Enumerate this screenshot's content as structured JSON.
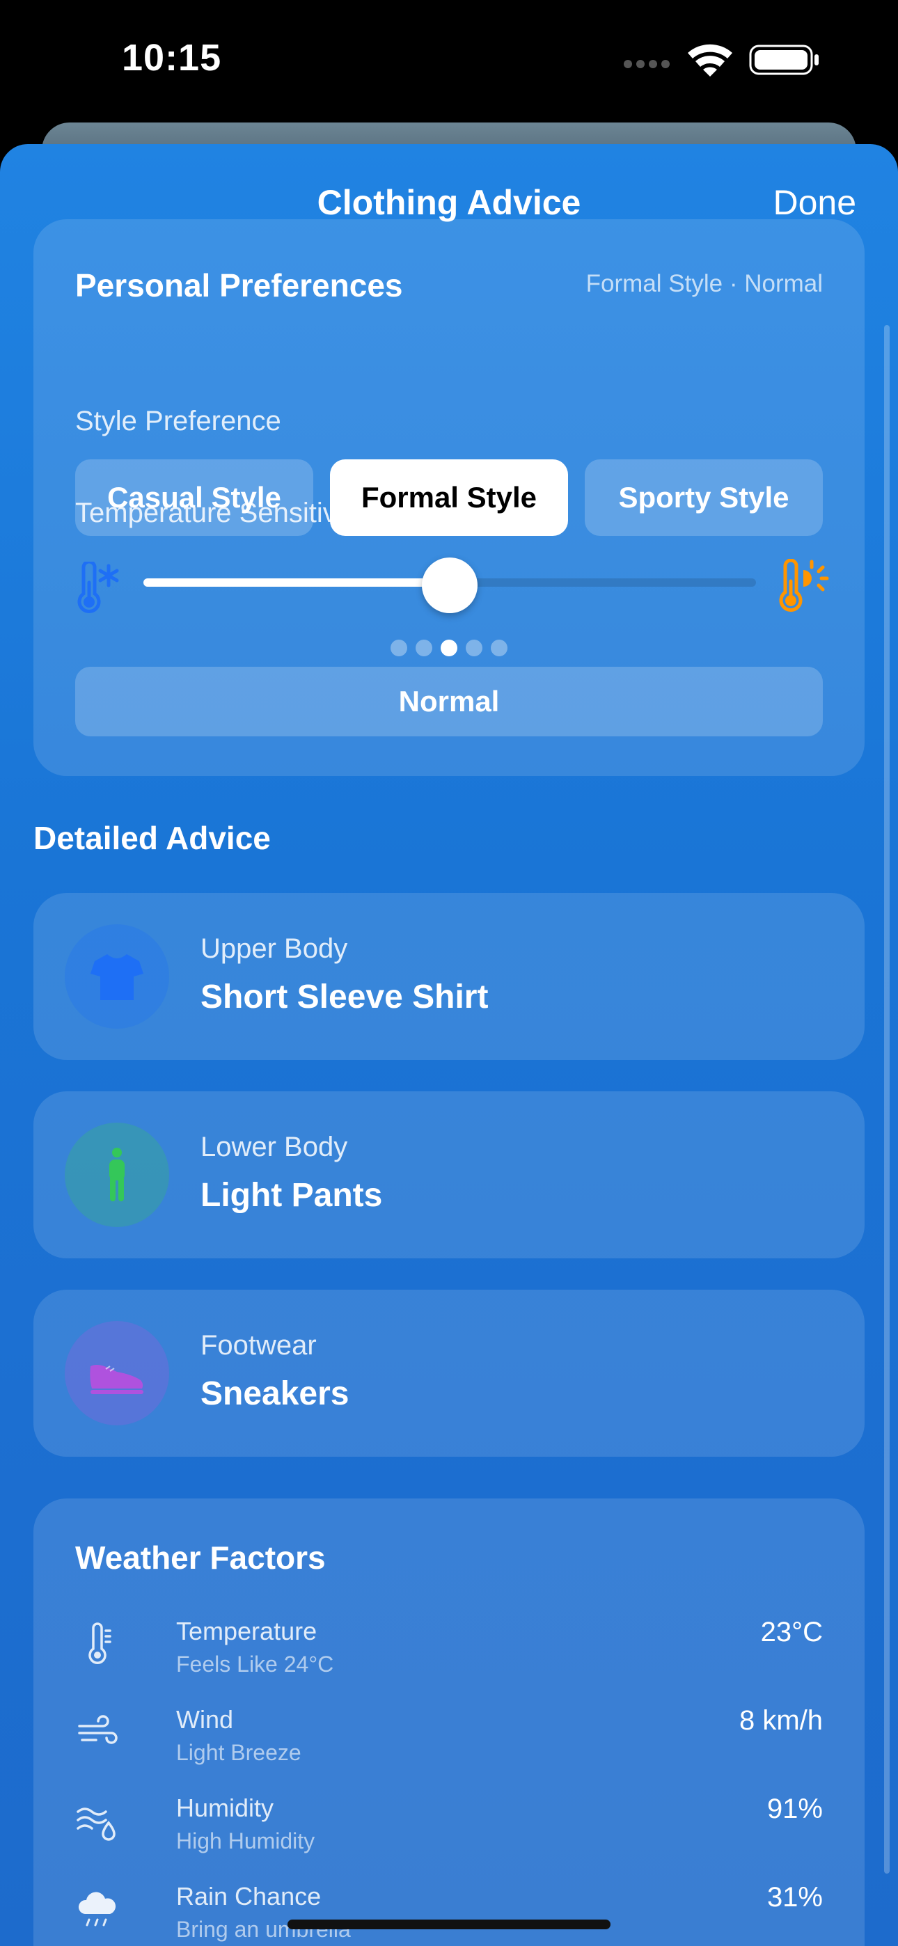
{
  "status": {
    "time": "10:15"
  },
  "sheet": {
    "title": "Clothing Advice",
    "done_label": "Done"
  },
  "preferences": {
    "title": "Personal Preferences",
    "summary": "Formal Style · Normal",
    "style_label": "Style Preference",
    "styles": [
      "Casual Style",
      "Formal Style",
      "Sporty Style"
    ],
    "selected_style": "Formal Style",
    "sensitivity_label": "Temperature Sensitivity",
    "sensitivity_level_index": 3,
    "sensitivity_levels_count": 5,
    "sensitivity_fraction": 0.5,
    "sensitivity_value": "Normal",
    "cold_icon": "thermometer-snowflake-icon",
    "hot_icon": "thermometer-sun-icon"
  },
  "detailed": {
    "heading": "Detailed Advice",
    "items": [
      {
        "category": "Upper Body",
        "value": "Short Sleeve Shirt",
        "icon": "tshirt-icon",
        "color": "#1e6ff5"
      },
      {
        "category": "Lower Body",
        "value": "Light Pants",
        "icon": "person-icon",
        "color": "#34c759"
      },
      {
        "category": "Footwear",
        "value": "Sneakers",
        "icon": "sneaker-icon",
        "color": "#af52de"
      }
    ]
  },
  "weather": {
    "title": "Weather Factors",
    "rows": [
      {
        "name": "Temperature",
        "note": "Feels Like 24°C",
        "value": "23°C",
        "icon": "thermometer-icon"
      },
      {
        "name": "Wind",
        "note": "Light Breeze",
        "value": "8 km/h",
        "icon": "wind-icon"
      },
      {
        "name": "Humidity",
        "note": "High Humidity",
        "value": "91%",
        "icon": "humidity-icon"
      },
      {
        "name": "Rain Chance",
        "note": "Bring an umbrella",
        "value": "31%",
        "icon": "cloud-rain-icon"
      }
    ]
  },
  "colors": {
    "sheet_blue": "#1f7ddc",
    "cold": "#1e6ff5",
    "hot": "#ff9500"
  }
}
